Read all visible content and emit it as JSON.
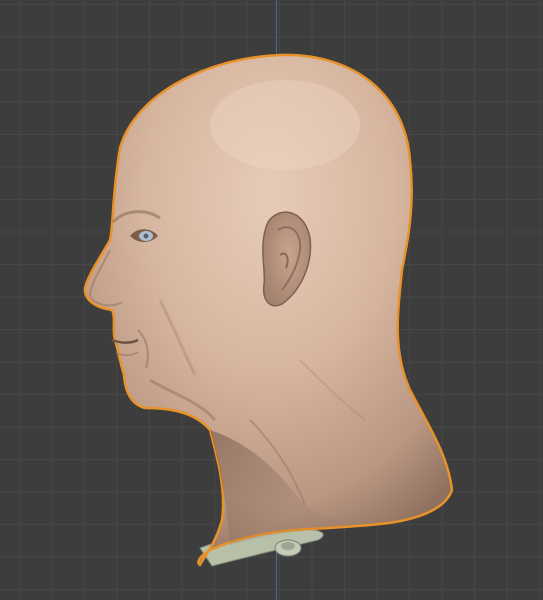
{
  "viewport": {
    "view": "side",
    "selected_object": "head",
    "colors": {
      "background": "#3d3d3d",
      "grid": "#474747",
      "z_axis": "#4f6a96",
      "selection_outline": "#e8922a",
      "skin": "#d8b8a0",
      "skin_shadow": "#8a6e5d",
      "base_mesh": "#b5bda8"
    },
    "grid": "on"
  }
}
